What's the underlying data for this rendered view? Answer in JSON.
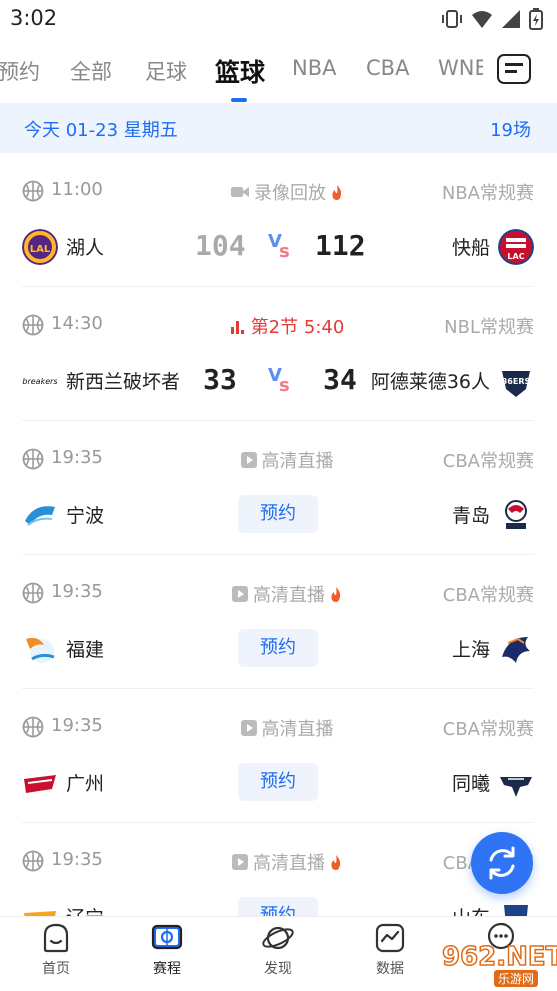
{
  "status_bar": {
    "time": "3:02"
  },
  "tabs": [
    "预约",
    "全部",
    "足球",
    "篮球",
    "NBA",
    "CBA",
    "WNBA"
  ],
  "active_tab": "篮球",
  "date_bar": {
    "date": "今天  01-23  星期五",
    "count": "19场"
  },
  "colors": {
    "accent": "#1f6df2",
    "live": "#e53935",
    "muted": "#aaaaaa"
  },
  "matches": [
    {
      "time": "11:00",
      "status": "录像回放",
      "status_icon": "video-icon",
      "hot": true,
      "league": "NBA常规赛",
      "home": "湖人",
      "away": "快船",
      "home_score": "104",
      "away_score": "112",
      "home_dim": true
    },
    {
      "time": "14:30",
      "status": "第2节  5:40",
      "status_icon": "live-bars-icon",
      "hot": false,
      "league": "NBL常规赛",
      "home": "新西兰破坏者",
      "away": "阿德莱德36人",
      "home_score": "33",
      "away_score": "34",
      "home_dim": false
    },
    {
      "time": "19:35",
      "status": "高清直播",
      "status_icon": "play-icon",
      "hot": false,
      "league": "CBA常规赛",
      "home": "宁波",
      "away": "青岛",
      "action": "预约"
    },
    {
      "time": "19:35",
      "status": "高清直播",
      "status_icon": "play-icon",
      "hot": true,
      "league": "CBA常规赛",
      "home": "福建",
      "away": "上海",
      "action": "预约"
    },
    {
      "time": "19:35",
      "status": "高清直播",
      "status_icon": "play-icon",
      "hot": false,
      "league": "CBA常规赛",
      "home": "广州",
      "away": "同曦",
      "action": "预约"
    },
    {
      "time": "19:35",
      "status": "高清直播",
      "status_icon": "play-icon",
      "hot": true,
      "league": "CBA常规赛",
      "home": "辽宁",
      "away": "山东",
      "action": "预约"
    }
  ],
  "bottom_nav": [
    {
      "label": "首页",
      "icon": "home-icon"
    },
    {
      "label": "赛程",
      "icon": "schedule-icon"
    },
    {
      "label": "发现",
      "icon": "discover-icon"
    },
    {
      "label": "数据",
      "icon": "data-icon"
    },
    {
      "label": "",
      "icon": "chat-icon"
    }
  ],
  "watermark": {
    "text": "962.NET",
    "sub": "乐游网"
  }
}
